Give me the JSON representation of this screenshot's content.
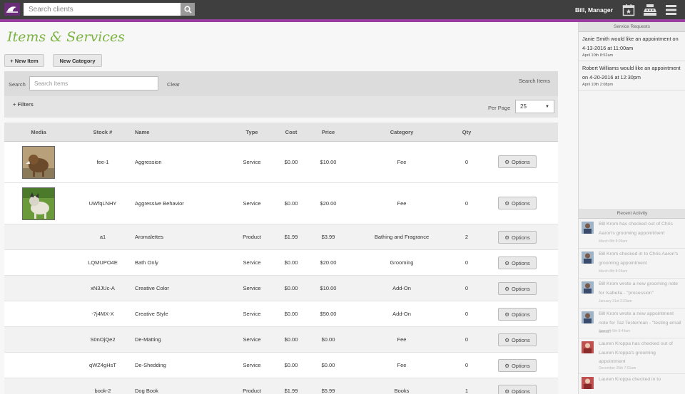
{
  "header": {
    "search_placeholder": "Search clients",
    "user_name": "Bill, Manager"
  },
  "page": {
    "title": "Items & Services",
    "new_item_label": "+ New Item",
    "new_category_label": "New Category"
  },
  "search": {
    "label": "Search",
    "placeholder": "Search Items",
    "clear_label": "Clear",
    "search_items_label": "Search Items",
    "filters_label": "+ Filters",
    "per_page_label": "Per Page",
    "per_page_value": "25"
  },
  "table": {
    "headers": [
      "Media",
      "Stock #",
      "Name",
      "Type",
      "Cost",
      "Price",
      "Category",
      "Qty"
    ],
    "options_label": "Options",
    "rows": [
      {
        "stock": "fee-1",
        "name": "Aggression",
        "type": "Service",
        "cost": "$0.00",
        "price": "$10.00",
        "category": "Fee",
        "qty": "0"
      },
      {
        "stock": "UWfqLNHY",
        "name": "Aggressive Behavior",
        "type": "Service",
        "cost": "$0.00",
        "price": "$20.00",
        "category": "Fee",
        "qty": "0"
      },
      {
        "stock": "a1",
        "name": "Aromalettes",
        "type": "Product",
        "cost": "$1.99",
        "price": "$3.99",
        "category": "Bathing and Fragrance",
        "qty": "2"
      },
      {
        "stock": "LQMUPO4E",
        "name": "Bath Only",
        "type": "Service",
        "cost": "$0.00",
        "price": "$20.00",
        "category": "Grooming",
        "qty": "0"
      },
      {
        "stock": "xN3JUc-A",
        "name": "Creative Color",
        "type": "Service",
        "cost": "$0.00",
        "price": "$10.00",
        "category": "Add-On",
        "qty": "0"
      },
      {
        "stock": "-7j4MX-X",
        "name": "Creative Style",
        "type": "Service",
        "cost": "$0.00",
        "price": "$50.00",
        "category": "Add-On",
        "qty": "0"
      },
      {
        "stock": "S0nOjQe2",
        "name": "De-Matting",
        "type": "Service",
        "cost": "$0.00",
        "price": "$0.00",
        "category": "Fee",
        "qty": "0"
      },
      {
        "stock": "qWZ4gHsT",
        "name": "De-Shedding",
        "type": "Service",
        "cost": "$0.00",
        "price": "$0.00",
        "category": "Fee",
        "qty": "0"
      },
      {
        "stock": "book-2",
        "name": "Dog Book",
        "type": "Product",
        "cost": "$1.99",
        "price": "$5.99",
        "category": "Books",
        "qty": "1"
      }
    ]
  },
  "sidebar": {
    "requests_title": "Service Requests",
    "requests": [
      {
        "text": "Janie Smith would like an appointment on 4-13-2016 at 11:00am",
        "time": "April 10th 8:52am"
      },
      {
        "text": "Robert Williams would like an appointment on 4-20-2016 at 12:30pm",
        "time": "April 10th 2:08pm"
      }
    ],
    "activity_title": "Recent Activity",
    "activity": [
      {
        "text": "Bill Krom has checked out of Chris Aaron's grooming appointment",
        "time": "March 8th 8:09am"
      },
      {
        "text": "Bill Krom checked in to Chris Aaron's grooming appointment",
        "time": "March 8th 8:04am"
      },
      {
        "text": "Bill Krom wrote a new grooming note for Isabella - \"procession\"",
        "time": "January 31st 2:23am"
      },
      {
        "text": "Bill Krom wrote a new appointment note for Taz Testerman - \"testing email send\"",
        "time": "January 5th 9:44am"
      },
      {
        "text": "Lauren Kroppa has checked out of Lauren Kroppa's grooming appointment",
        "time": "December 25th 7:01am"
      },
      {
        "text": "Lauren Kroppa checked in to",
        "time": ""
      }
    ]
  },
  "colors": {
    "topbar": "#3f3f3f",
    "accent": "#9a3fa1",
    "title_green": "#7cb342"
  }
}
